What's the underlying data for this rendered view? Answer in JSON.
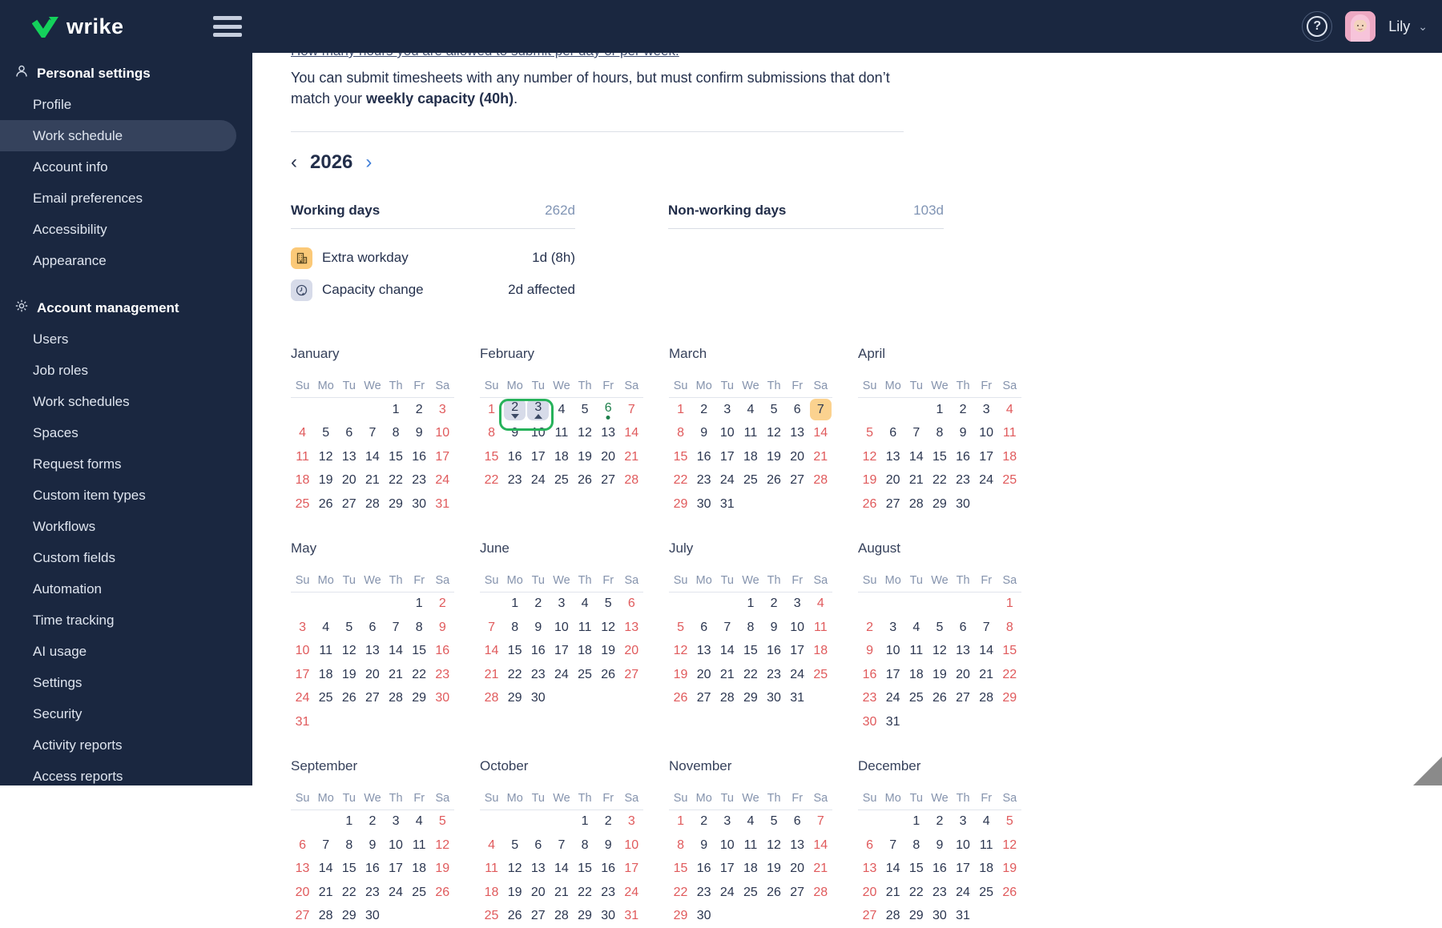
{
  "topbar": {
    "brand": "wrike",
    "hamburger_icon": "hamburger-menu-icon",
    "help_icon": "help-question-icon",
    "user_name": "Lily",
    "chevron": "⌄"
  },
  "sidebar": {
    "sections": [
      {
        "label": "Personal settings",
        "icon": "person-icon",
        "items": [
          "Profile",
          "Work schedule",
          "Account info",
          "Email preferences",
          "Accessibility",
          "Appearance"
        ],
        "selected": "Work schedule"
      },
      {
        "label": "Account management",
        "icon": "gear-icon",
        "items": [
          "Users",
          "Job roles",
          "Work schedules",
          "Spaces",
          "Request forms",
          "Custom item types",
          "Workflows",
          "Custom fields",
          "Automation",
          "Time tracking",
          "AI usage",
          "Settings",
          "Security",
          "Activity reports",
          "Access reports"
        ],
        "selected": ""
      }
    ]
  },
  "content": {
    "clipped_line": "How many hours you are allowed to submit per day or per week.",
    "intro_pre": "You can submit timesheets with any number of hours, but must confirm submissions that don’t match your ",
    "intro_bold": "weekly capacity (40h)",
    "intro_post": ".",
    "prev_icon": "‹",
    "next_icon": "›",
    "year": "2026",
    "stats": [
      {
        "label": "Working days",
        "value": "262d"
      },
      {
        "label": "Non-working days",
        "value": "103d"
      }
    ],
    "legend": [
      {
        "icon": "building-icon",
        "icon_class": "amber",
        "label": "Extra workday",
        "value": "1d (8h)"
      },
      {
        "icon": "clock-icon",
        "icon_class": "lavender",
        "label": "Capacity change",
        "value": "2d affected"
      }
    ]
  },
  "calendar": {
    "weekdays": [
      "Su",
      "Mo",
      "Tu",
      "We",
      "Th",
      "Fr",
      "Sa"
    ],
    "months": [
      {
        "name": "January",
        "start": 4,
        "days": 31,
        "specials": {}
      },
      {
        "name": "February",
        "start": 0,
        "days": 28,
        "specials": {
          "2": "range-start",
          "3": "range-end",
          "6": "capacity"
        },
        "selection": {
          "week": 0,
          "from_col": 1,
          "to_col": 2
        }
      },
      {
        "name": "March",
        "start": 0,
        "days": 31,
        "specials": {
          "7": "extra"
        }
      },
      {
        "name": "April",
        "start": 3,
        "days": 30,
        "specials": {}
      },
      {
        "name": "May",
        "start": 5,
        "days": 31,
        "specials": {}
      },
      {
        "name": "June",
        "start": 1,
        "days": 30,
        "specials": {}
      },
      {
        "name": "July",
        "start": 3,
        "days": 31,
        "specials": {}
      },
      {
        "name": "August",
        "start": 6,
        "days": 31,
        "specials": {}
      },
      {
        "name": "September",
        "start": 2,
        "days": 30,
        "specials": {}
      },
      {
        "name": "October",
        "start": 4,
        "days": 31,
        "specials": {}
      },
      {
        "name": "November",
        "start": 0,
        "days": 30,
        "specials": {}
      },
      {
        "name": "December",
        "start": 2,
        "days": 31,
        "specials": {}
      }
    ]
  },
  "colors": {
    "navy": "#1a2740",
    "selected_pill": "#35425c",
    "brand_green": "#14d15b",
    "weekend_red": "#e05a5c",
    "day_text": "#2b3650",
    "muted_value": "#8094b4",
    "amber_chip": "#fbd28f",
    "lavender_chip": "#d7dbe9",
    "selection_green": "#27b25b",
    "capacity_green": "#1d7f4b"
  }
}
